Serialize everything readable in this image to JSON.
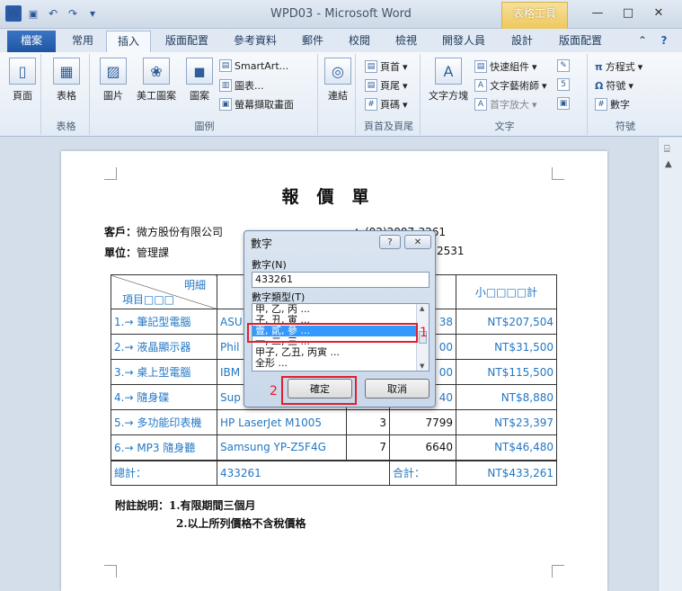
{
  "window": {
    "title": "WPD03 - Microsoft Word",
    "context_group": "表格工具"
  },
  "qat": {
    "word_logo": "W",
    "save_icon": "💾",
    "undo_icon": "↶",
    "redo_icon": "↷",
    "more_icon": "▾"
  },
  "controls": {
    "minimize": "—",
    "maximize": "□",
    "close": "✕"
  },
  "tabs": [
    "檔案",
    "常用",
    "插入",
    "版面配置",
    "參考資料",
    "郵件",
    "校閱",
    "檢視",
    "開發人員",
    "設計",
    "版面配置"
  ],
  "ribbon": {
    "pages": {
      "label": "頁面",
      "group": ""
    },
    "table": {
      "label": "表格",
      "group": "表格"
    },
    "illus": {
      "picture": "圖片",
      "clipart": "美工圖案",
      "shapes": "圖案",
      "smartart": "SmartArt...",
      "chart": "圖表...",
      "screenshot": "螢幕擷取畫面",
      "group": "圖例"
    },
    "links": {
      "label": "連結"
    },
    "headerfooter": {
      "header": "頁首",
      "footer": "頁尾",
      "pagenum": "頁碼",
      "group": "頁首及頁尾"
    },
    "text": {
      "textbox": "文字方塊",
      "quickparts": "快速組件",
      "wordart": "文字藝術師",
      "dropcap": "首字放大",
      "group": "文字"
    },
    "symbols": {
      "equation": "方程式",
      "symbol": "符號",
      "number": "數字",
      "group": "符號"
    }
  },
  "document": {
    "title": "報價單",
    "customer_label": "客戶：",
    "customer": "微方股份有限公司",
    "unit_label": "單位：",
    "unit": "管理課",
    "phone_frag1": "：(02)2007-3261",
    "phone_frag2": "2531",
    "header_row": {
      "detail": "明細",
      "item": "項目□□□",
      "subtotal": "小□□□□計"
    },
    "rows": [
      {
        "item": "1.→ 筆記型電腦",
        "model": "ASU",
        "price": "38",
        "subtotal": "NT$207,504"
      },
      {
        "item": "2.→ 液晶顯示器",
        "model": "Phil",
        "price": "00",
        "subtotal": "NT$31,500"
      },
      {
        "item": "3.→ 桌上型電腦",
        "model": "IBM",
        "price": "00",
        "subtotal": "NT$115,500"
      },
      {
        "item": "4.→ 隨身碟",
        "model": "Sup",
        "price": "40",
        "subtotal": "NT$8,880"
      },
      {
        "item": "5.→ 多功能印表機",
        "model": "HP LaserJet M1005",
        "qty": "3",
        "price": "7799",
        "subtotal": "NT$23,397"
      },
      {
        "item": "6.→ MP3 隨身聽",
        "model": "Samsung YP-Z5F4G",
        "qty": "7",
        "price": "6640",
        "subtotal": "NT$46,480"
      }
    ],
    "total_row": {
      "label": "總計：",
      "value": "433261",
      "sum_label": "合計：",
      "sum": "NT$433,261"
    },
    "notes_label": "附註說明：",
    "note1": "1.有限期間三個月",
    "note2": "2.以上所列價格不含稅價格"
  },
  "dialog": {
    "title": "數字",
    "help": "?",
    "close": "✕",
    "number_label": "數字(N)",
    "number_value": "433261",
    "type_label": "數字類型(T)",
    "types": [
      "甲, 乙, 丙 ...",
      "子, 丑, 寅 ...",
      "壹, 貳, 參 ...",
      "一, 二, 三 ...",
      "甲子, 乙丑, 丙寅 ...",
      "全形 ..."
    ],
    "selected_index": 2,
    "ok": "確定",
    "cancel": "取消",
    "marker1": "1",
    "marker2": "2"
  }
}
